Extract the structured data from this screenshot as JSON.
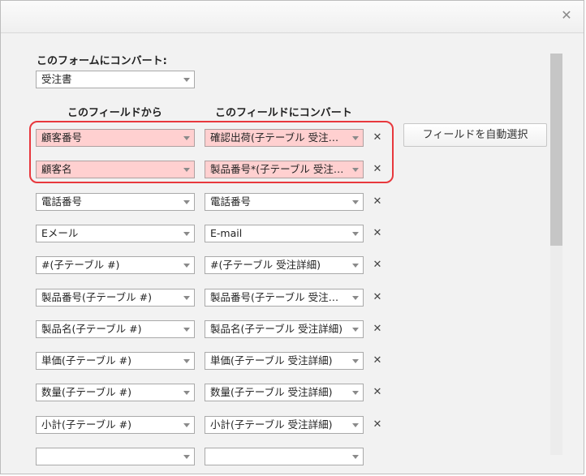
{
  "dialog": {
    "close_icon": "close-icon",
    "form_label": "このフォームにコンバート:",
    "form_value": "受注書",
    "col_from": "このフィールドから",
    "col_to": "このフィールドにコンバート",
    "auto_select_button": "フィールドを自動選択",
    "remove_symbol": "✕",
    "error_color": "#ffd0d0",
    "highlight_color": "#e8383d",
    "rows": [
      {
        "from": "顧客番号",
        "to": "確認出荷(子テーブル 受注…",
        "error": true
      },
      {
        "from": "顧客名",
        "to": "製品番号*(子テーブル 受注…",
        "error": true
      },
      {
        "from": "電話番号",
        "to": "電話番号"
      },
      {
        "from": "Eメール",
        "to": "E-mail"
      },
      {
        "from": "#(子テーブル #)",
        "to": "#(子テーブル 受注詳細)"
      },
      {
        "from": "製品番号(子テーブル #)",
        "to": "製品番号(子テーブル 受注…"
      },
      {
        "from": "製品名(子テーブル #)",
        "to": "製品名(子テーブル 受注詳細)"
      },
      {
        "from": "単価(子テーブル #)",
        "to": "単価(子テーブル 受注詳細)"
      },
      {
        "from": "数量(子テーブル #)",
        "to": "数量(子テーブル 受注詳細)"
      },
      {
        "from": "小計(子テーブル #)",
        "to": "小計(子テーブル 受注詳細)"
      },
      {
        "from": "",
        "to": ""
      }
    ]
  }
}
